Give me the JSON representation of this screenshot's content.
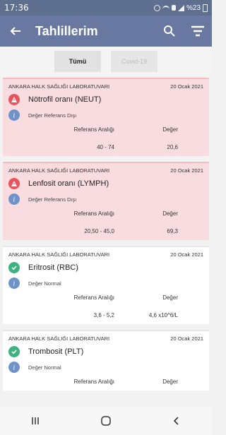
{
  "status": {
    "time": "17:36",
    "right_text": "%23"
  },
  "app": {
    "title": "Tahlillerim"
  },
  "filters": [
    {
      "label": "Tümü"
    },
    {
      "label": "Covid-19"
    }
  ],
  "cards": [
    {
      "lab": "ANKARA HALK SAĞLIĞI LABORATUVARI",
      "date": "20 Ocak 2021",
      "test": "Nötrofil oranı (NEUT)",
      "note": "Değer Referans Dışı",
      "ref_header": "Referans Aralığı",
      "val_header": "Değer",
      "ref": "40 - 74",
      "value": "20,6"
    },
    {
      "lab": "ANKARA HALK SAĞLIĞI LABORATUVARI",
      "date": "20 Ocak 2021",
      "test": "Lenfosit oranı (LYMPH)",
      "note": "Değer Referans Dışı",
      "ref_header": "Referans Aralığı",
      "val_header": "Değer",
      "ref": "20,50 - 45,0",
      "value": "69,3"
    },
    {
      "lab": "ANKARA HALK SAĞLIĞI LABORATUVARI",
      "date": "20 Ocak 2021",
      "test": "Eritrosit (RBC)",
      "note": "Değer Normal",
      "ref_header": "Referans Aralığı",
      "val_header": "Değer",
      "ref": "3,6 - 5,2",
      "value": "4,6 x10^6/L"
    },
    {
      "lab": "ANKARA HALK SAĞLIĞI LABORATUVARI",
      "date": "20 Ocak 2021",
      "test": "Trombosit (PLT)",
      "note": "Değer Normal",
      "ref_header": "Referans Aralığı",
      "val_header": "Değer",
      "ref": "",
      "value": ""
    }
  ],
  "colors": {
    "appbar": "#6878a0",
    "warn": "#e8535c",
    "ok": "#3fb281",
    "info": "#6f93c8"
  }
}
